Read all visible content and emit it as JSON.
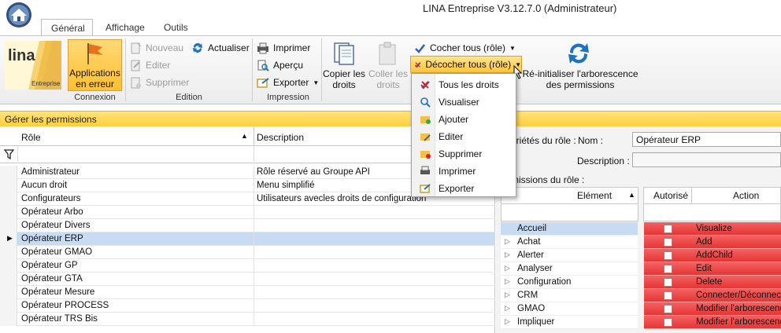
{
  "window": {
    "title": "LINA Entreprise  V3.12.7.0  (Administrateur)"
  },
  "tabs": [
    "Général",
    "Affichage",
    "Outils"
  ],
  "ribbon": {
    "logo_text": "lina",
    "logo_sub": "Entreprise",
    "app_errors": {
      "line1": "Applications",
      "line2": "en erreur"
    },
    "connexion_label": "Connexion",
    "nouveau": "Nouveau",
    "editer": "Editer",
    "supprimer": "Supprimer",
    "actualiser": "Actualiser",
    "edition_label": "Edition",
    "imprimer": "Imprimer",
    "apercu": "Aperçu",
    "exporter": "Exporter",
    "impression_label": "Impression",
    "copier": {
      "line1": "Copier les",
      "line2": "droits"
    },
    "coller": {
      "line1": "Coller les",
      "line2": "droits"
    },
    "cocher_tous": "Cocher tous (rôle)",
    "decocher_tous": "Décocher tous (rôle)",
    "reinit": {
      "line1": "Ré-initialiser l'arborescence",
      "line2": "des permissions"
    }
  },
  "dropdown": {
    "items": [
      "Tous les droits",
      "Visualiser",
      "Ajouter",
      "Editer",
      "Supprimer",
      "Imprimer",
      "Exporter"
    ]
  },
  "panel": {
    "header": "Gérer les permissions"
  },
  "grid": {
    "columns": [
      "Rôle",
      "Description"
    ],
    "rows": [
      {
        "role": "Administrateur",
        "desc": "Rôle réservé au Groupe API"
      },
      {
        "role": "Aucun droit",
        "desc": "Menu simplifié"
      },
      {
        "role": "Configurateurs",
        "desc": "Utilisateurs avecles droits de configuration"
      },
      {
        "role": "Opérateur Arbo",
        "desc": ""
      },
      {
        "role": "Opérateur Divers",
        "desc": ""
      },
      {
        "role": "Opérateur ERP",
        "desc": ""
      },
      {
        "role": "Opérateur GMAO",
        "desc": ""
      },
      {
        "role": "Opérateur GP",
        "desc": ""
      },
      {
        "role": "Opérateur GTA",
        "desc": ""
      },
      {
        "role": "Opérateur Mesure",
        "desc": ""
      },
      {
        "role": "Opérateur PROCESS",
        "desc": ""
      },
      {
        "role": "Opérateur TRS Bis",
        "desc": ""
      }
    ],
    "selected_row": "Opérateur ERP"
  },
  "role_props": {
    "section_label": "priétés du rôle :",
    "nom_label": "Nom :",
    "nom_value": "Opérateur ERP",
    "description_label": "Description :",
    "description_value": "",
    "permissions_label": "missions du rôle :"
  },
  "elements": {
    "column": "Elément",
    "items": [
      "Accueil",
      "Achat",
      "Alerter",
      "Analyser",
      "Configuration",
      "CRM",
      "GMAO",
      "Impliquer"
    ]
  },
  "actions": {
    "columns": [
      "Autorisé",
      "Action"
    ],
    "items": [
      "Visualize",
      "Add",
      "AddChild",
      "Edit",
      "Delete",
      "Connecter/Déconnect",
      "Modifier l'arborescenc",
      "Modifier l'arborescenc"
    ]
  },
  "colors": {
    "accent_yellow": "#ffcf3c",
    "selection": "#c7dcf3",
    "denied_red": "#e83434"
  }
}
